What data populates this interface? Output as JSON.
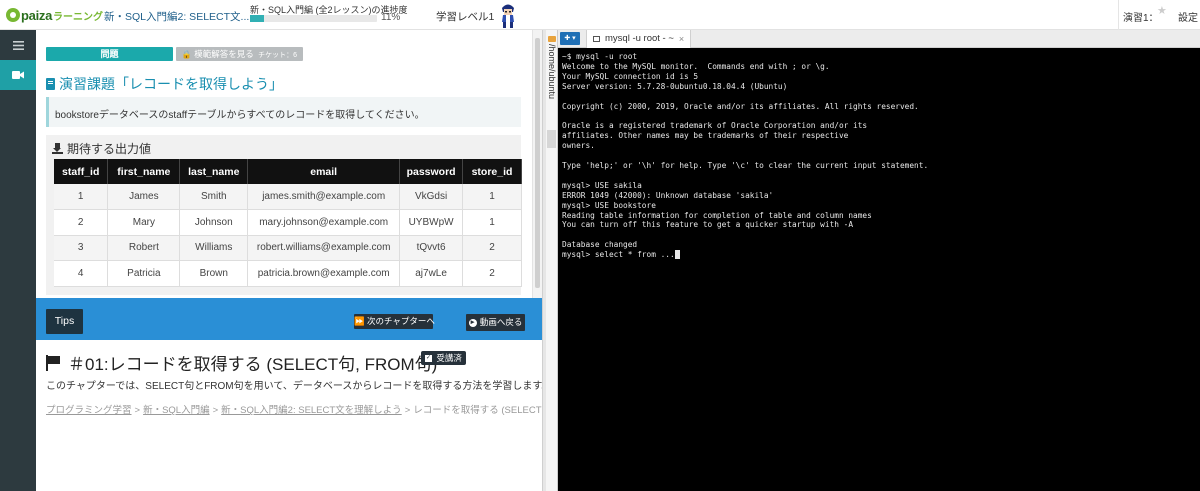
{
  "header": {
    "logo_text": "paiza",
    "logo_sub": "ラーニング",
    "course_title": "新・SQL入門編2: SELECT文...",
    "progress_label": "新・SQL入門編 (全2レッスン)の進捗度",
    "progress_value": 11,
    "progress_text": "11%",
    "level": "学習レベル1",
    "practice": "演習1：",
    "settings": "設定"
  },
  "sidebar": {
    "items": [
      {
        "icon": "menu-icon",
        "active": false
      },
      {
        "icon": "video-icon",
        "active": true
      }
    ]
  },
  "exercise": {
    "tab_question": "問題",
    "tab_answer": "模範解答を見る",
    "ticket": "チケット：6",
    "title": "演習課題「レコードを取得しよう」",
    "description": "bookstoreデータベースのstaffテーブルからすべてのレコードを取得してください。",
    "expected_heading": "期待する出力値",
    "columns": [
      "staff_id",
      "first_name",
      "last_name",
      "email",
      "password",
      "store_id"
    ],
    "rows": [
      [
        "1",
        "James",
        "Smith",
        "james.smith@example.com",
        "VkGdsi",
        "1"
      ],
      [
        "2",
        "Mary",
        "Johnson",
        "mary.johnson@example.com",
        "UYBWpW",
        "1"
      ],
      [
        "3",
        "Robert",
        "Williams",
        "robert.williams@example.com",
        "tQvvt6",
        "2"
      ],
      [
        "4",
        "Patricia",
        "Brown",
        "patricia.brown@example.com",
        "aj7wLe",
        "2"
      ]
    ]
  },
  "tips": {
    "tips_label": "Tips",
    "next_chapter": "次のチャプターへ",
    "back_to_video": "動画へ戻る"
  },
  "chapter": {
    "title": "＃01:レコードを取得する (SELECT句, FROM句)",
    "badge": "受講済",
    "description": "このチャプターでは、SELECT句とFROM句を用いて、データベースからレコードを取得する方法を学習します。",
    "breadcrumbs": [
      "プログラミング学習",
      "新・SQL入門編",
      "新・SQL入門編2: SELECT文を理解しよう"
    ],
    "breadcrumb_current": "レコードを取得する (SELECT句, FROM句)"
  },
  "filetree": {
    "path": "/home/ubuntu"
  },
  "terminal": {
    "add_label": "✚ ▾",
    "tab_title": "mysql -u root - ~",
    "close": "×",
    "lines": [
      "~$ mysql -u root",
      "Welcome to the MySQL monitor.  Commands end with ; or \\g.",
      "Your MySQL connection id is 5",
      "Server version: 5.7.28-0ubuntu0.18.04.4 (Ubuntu)",
      "",
      "Copyright (c) 2000, 2019, Oracle and/or its affiliates. All rights reserved.",
      "",
      "Oracle is a registered trademark of Oracle Corporation and/or its",
      "affiliates. Other names may be trademarks of their respective",
      "owners.",
      "",
      "Type 'help;' or '\\h' for help. Type '\\c' to clear the current input statement.",
      "",
      "mysql> USE sakila",
      "ERROR 1049 (42000): Unknown database 'sakila'",
      "mysql> USE bookstore",
      "Reading table information for completion of table and column names",
      "You can turn off this feature to get a quicker startup with -A",
      "",
      "Database changed"
    ],
    "prompt_line": "mysql> select * from ..."
  }
}
